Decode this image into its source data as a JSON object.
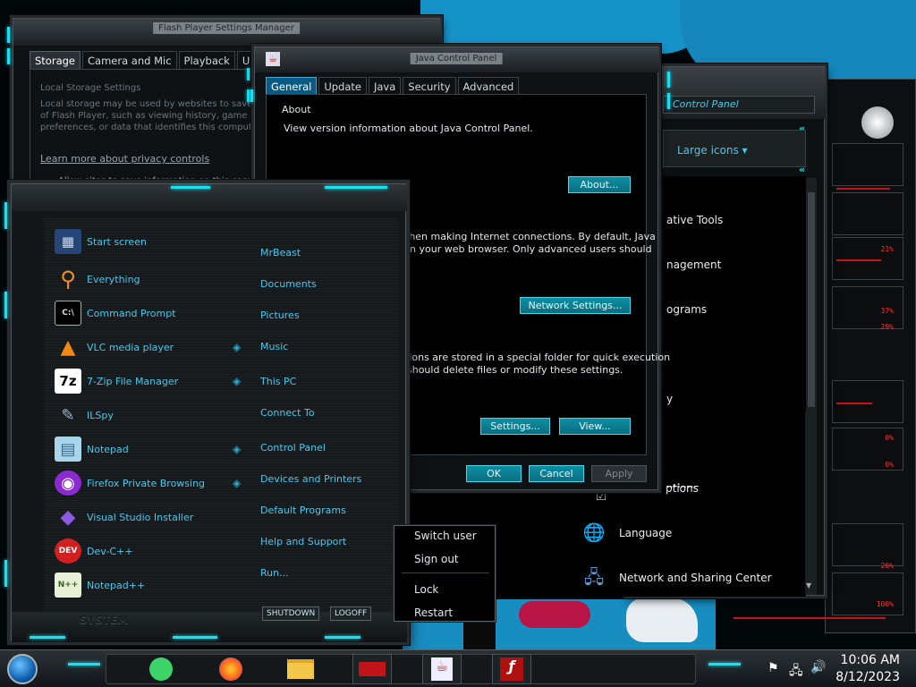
{
  "flash_window": {
    "title": "Flash Player Settings Manager",
    "tabs": [
      "Storage",
      "Camera and Mic",
      "Playback",
      "Updates"
    ],
    "section_title": "Local Storage Settings",
    "body_lines": [
      "Local storage may be used by websites to save",
      "of Flash Player, such as viewing history, game p",
      "preferences, or data that identifies this compute"
    ],
    "link": "Learn more about privacy controls",
    "radio": "Allow sites to save information on this comp"
  },
  "java_window": {
    "title": "Java Control Panel",
    "tabs": [
      "General",
      "Update",
      "Java",
      "Security",
      "Advanced"
    ],
    "about_heading": "About",
    "about_text": "View version information about Java Control Panel.",
    "about_button": "About...",
    "network_text_1": "then making Internet connections.  By default, Java",
    "network_text_2": "in your web browser.  Only advanced users should",
    "network_button": "Network Settings...",
    "temp_text_1": "tions are stored in a special folder for quick execution",
    "temp_text_2": "should delete files or modify these settings.",
    "settings_button": "Settings...",
    "view_button": "View...",
    "ok_button": "OK",
    "cancel_button": "Cancel",
    "apply_button": "Apply"
  },
  "control_panel": {
    "breadcrumb": "Control Panel",
    "view_by": "Large icons",
    "items": [
      {
        "label": "ative Tools",
        "icon_glyph": ""
      },
      {
        "label": "nagement",
        "icon_glyph": ""
      },
      {
        "label": "ograms",
        "icon_glyph": ""
      },
      {
        "label": "y",
        "icon_glyph": ""
      },
      {
        "label": "ptions",
        "icon_glyph": "☑"
      },
      {
        "label": "Language",
        "icon_glyph": "🌐"
      },
      {
        "label": "Network and Sharing Center",
        "icon_glyph": "🖧"
      }
    ]
  },
  "start_menu": {
    "left_items": [
      {
        "label": "Start screen",
        "icon": "start-screen-icon",
        "icon_glyph": "▦",
        "color": "#2a4a7a"
      },
      {
        "label": "Everything",
        "icon": "magnifier-icon",
        "icon_glyph": "⚲",
        "color": "#e8801a"
      },
      {
        "label": "Command Prompt",
        "icon": "command-prompt-icon",
        "icon_glyph": "C:\\",
        "color": "#000000"
      },
      {
        "label": "VLC media player",
        "icon": "vlc-icon",
        "icon_glyph": "▲",
        "color": "#f08a10"
      },
      {
        "label": "7-Zip File Manager",
        "icon": "seven-zip-icon",
        "icon_glyph": "7z",
        "color": "#ffffff"
      },
      {
        "label": "ILSpy",
        "icon": "ilspy-icon",
        "icon_glyph": "✎",
        "color": "#8aa0b8"
      },
      {
        "label": "Notepad",
        "icon": "notepad-icon",
        "icon_glyph": "▤",
        "color": "#7ab8d8"
      },
      {
        "label": "Firefox Private Browsing",
        "icon": "firefox-private-icon",
        "icon_glyph": "◉",
        "color": "#8a2ad0"
      },
      {
        "label": "Visual Studio Installer",
        "icon": "visual-studio-icon",
        "icon_glyph": "◆",
        "color": "#6a3ac0"
      },
      {
        "label": "Dev-C++",
        "icon": "devcpp-icon",
        "icon_glyph": "DEV",
        "color": "#d02020"
      },
      {
        "label": "Notepad++",
        "icon": "notepadpp-icon",
        "icon_glyph": "N++",
        "color": "#9ac040"
      }
    ],
    "right_items": [
      "MrBeast",
      "Documents",
      "Pictures",
      "Music",
      "This PC",
      "Connect To",
      "Control Panel",
      "Devices and Printers",
      "Default Programs",
      "Help and Support",
      "Run..."
    ],
    "shutdown_label": "SHUTDOWN",
    "logoff_label": "LOGOFF",
    "system_label": "SYSTEM"
  },
  "context_menu": {
    "items": [
      "Switch user",
      "Sign out",
      "Lock",
      "Restart"
    ]
  },
  "taskbar": {
    "time": "10:06 AM",
    "date": "8/12/2023"
  },
  "gadget": {
    "values": [
      "21%",
      "37%",
      "29%",
      "0%",
      "0%",
      "26%",
      "100%"
    ]
  },
  "colors": {
    "accent_cyan": "#19e0f0",
    "button_teal": "#0a7e92",
    "wallpaper_blue": "#1593c8"
  }
}
